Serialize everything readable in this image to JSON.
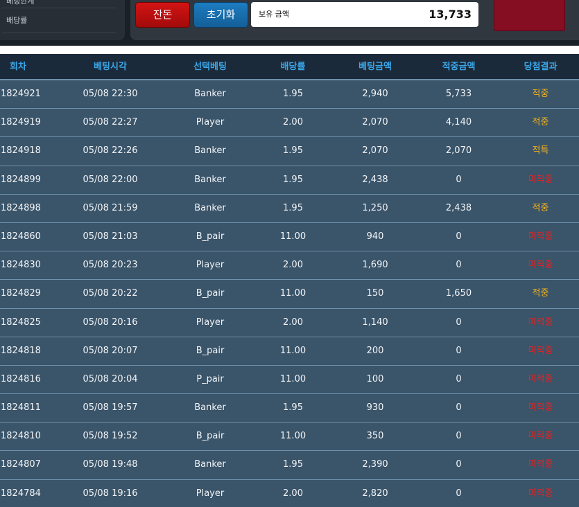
{
  "sidebar": {
    "cut_item": "베팅한계",
    "item": "배당률"
  },
  "controls": {
    "cancel_label": "잔돈",
    "reset_label": "초기화",
    "balance_label": "보유 금액",
    "balance_value": "13,733",
    "accent_red": "#850e22"
  },
  "table": {
    "headers": [
      "회차",
      "베팅시각",
      "선택베팅",
      "배당률",
      "베팅금액",
      "적중금액",
      "당첨결과"
    ],
    "rows": [
      {
        "round": "1824921",
        "time": "05/08 22:30",
        "pick": "Banker",
        "odds": "1.95",
        "bet": "2,940",
        "win": "5,733",
        "result": "적중",
        "type": "win"
      },
      {
        "round": "1824919",
        "time": "05/08 22:27",
        "pick": "Player",
        "odds": "2.00",
        "bet": "2,070",
        "win": "4,140",
        "result": "적중",
        "type": "win"
      },
      {
        "round": "1824918",
        "time": "05/08 22:26",
        "pick": "Banker",
        "odds": "1.95",
        "bet": "2,070",
        "win": "2,070",
        "result": "적특",
        "type": "win"
      },
      {
        "round": "1824899",
        "time": "05/08 22:00",
        "pick": "Banker",
        "odds": "1.95",
        "bet": "2,438",
        "win": "0",
        "result": "미적중",
        "type": "lose"
      },
      {
        "round": "1824898",
        "time": "05/08 21:59",
        "pick": "Banker",
        "odds": "1.95",
        "bet": "1,250",
        "win": "2,438",
        "result": "적중",
        "type": "win"
      },
      {
        "round": "1824860",
        "time": "05/08 21:03",
        "pick": "B_pair",
        "odds": "11.00",
        "bet": "940",
        "win": "0",
        "result": "미적중",
        "type": "lose"
      },
      {
        "round": "1824830",
        "time": "05/08 20:23",
        "pick": "Player",
        "odds": "2.00",
        "bet": "1,690",
        "win": "0",
        "result": "미적중",
        "type": "lose"
      },
      {
        "round": "1824829",
        "time": "05/08 20:22",
        "pick": "B_pair",
        "odds": "11.00",
        "bet": "150",
        "win": "1,650",
        "result": "적중",
        "type": "win"
      },
      {
        "round": "1824825",
        "time": "05/08 20:16",
        "pick": "Player",
        "odds": "2.00",
        "bet": "1,140",
        "win": "0",
        "result": "미적중",
        "type": "lose"
      },
      {
        "round": "1824818",
        "time": "05/08 20:07",
        "pick": "B_pair",
        "odds": "11.00",
        "bet": "200",
        "win": "0",
        "result": "미적중",
        "type": "lose"
      },
      {
        "round": "1824816",
        "time": "05/08 20:04",
        "pick": "P_pair",
        "odds": "11.00",
        "bet": "100",
        "win": "0",
        "result": "미적중",
        "type": "lose"
      },
      {
        "round": "1824811",
        "time": "05/08 19:57",
        "pick": "Banker",
        "odds": "1.95",
        "bet": "930",
        "win": "0",
        "result": "미적중",
        "type": "lose"
      },
      {
        "round": "1824810",
        "time": "05/08 19:52",
        "pick": "B_pair",
        "odds": "11.00",
        "bet": "350",
        "win": "0",
        "result": "미적중",
        "type": "lose"
      },
      {
        "round": "1824807",
        "time": "05/08 19:48",
        "pick": "Banker",
        "odds": "1.95",
        "bet": "2,390",
        "win": "0",
        "result": "미적중",
        "type": "lose"
      },
      {
        "round": "1824784",
        "time": "05/08 19:16",
        "pick": "Player",
        "odds": "2.00",
        "bet": "2,820",
        "win": "0",
        "result": "미적중",
        "type": "lose"
      }
    ]
  }
}
